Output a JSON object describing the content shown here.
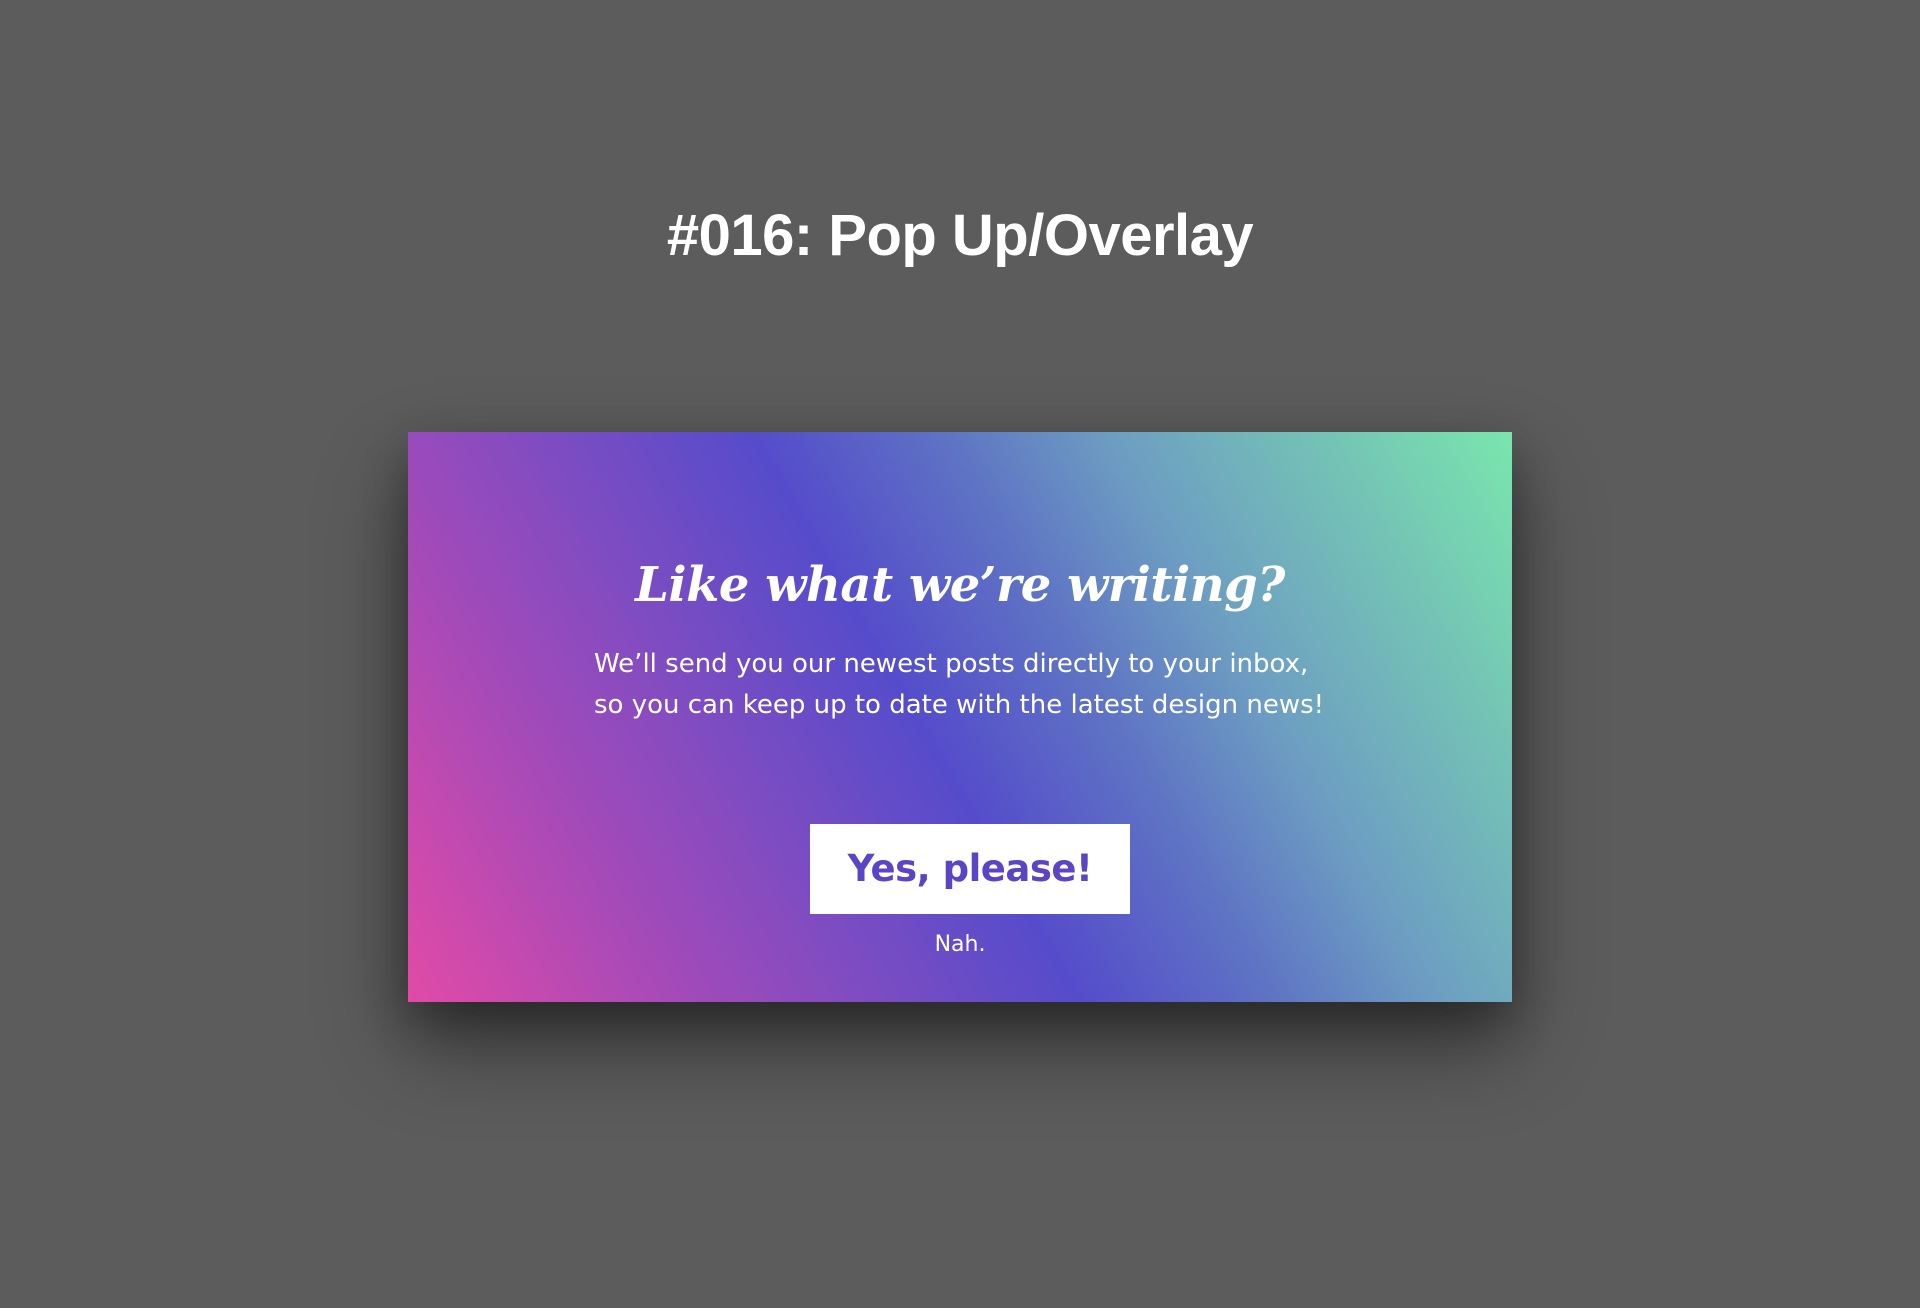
{
  "page": {
    "title": "#016: Pop Up/Overlay",
    "background_color": "#5c5c5c"
  },
  "popup": {
    "heading": "Like what we’re writing?",
    "body_lines": [
      "We’ll send you our newest posts directly to your inbox,",
      "so you can keep up to date with the latest design news!"
    ],
    "primary_button_label": "Yes, please!",
    "dismiss_label": "Nah.",
    "gradient_colors": [
      "#e24aa6",
      "#554ccb",
      "#79e6ad"
    ],
    "button_text_color": "#5a45c6"
  }
}
